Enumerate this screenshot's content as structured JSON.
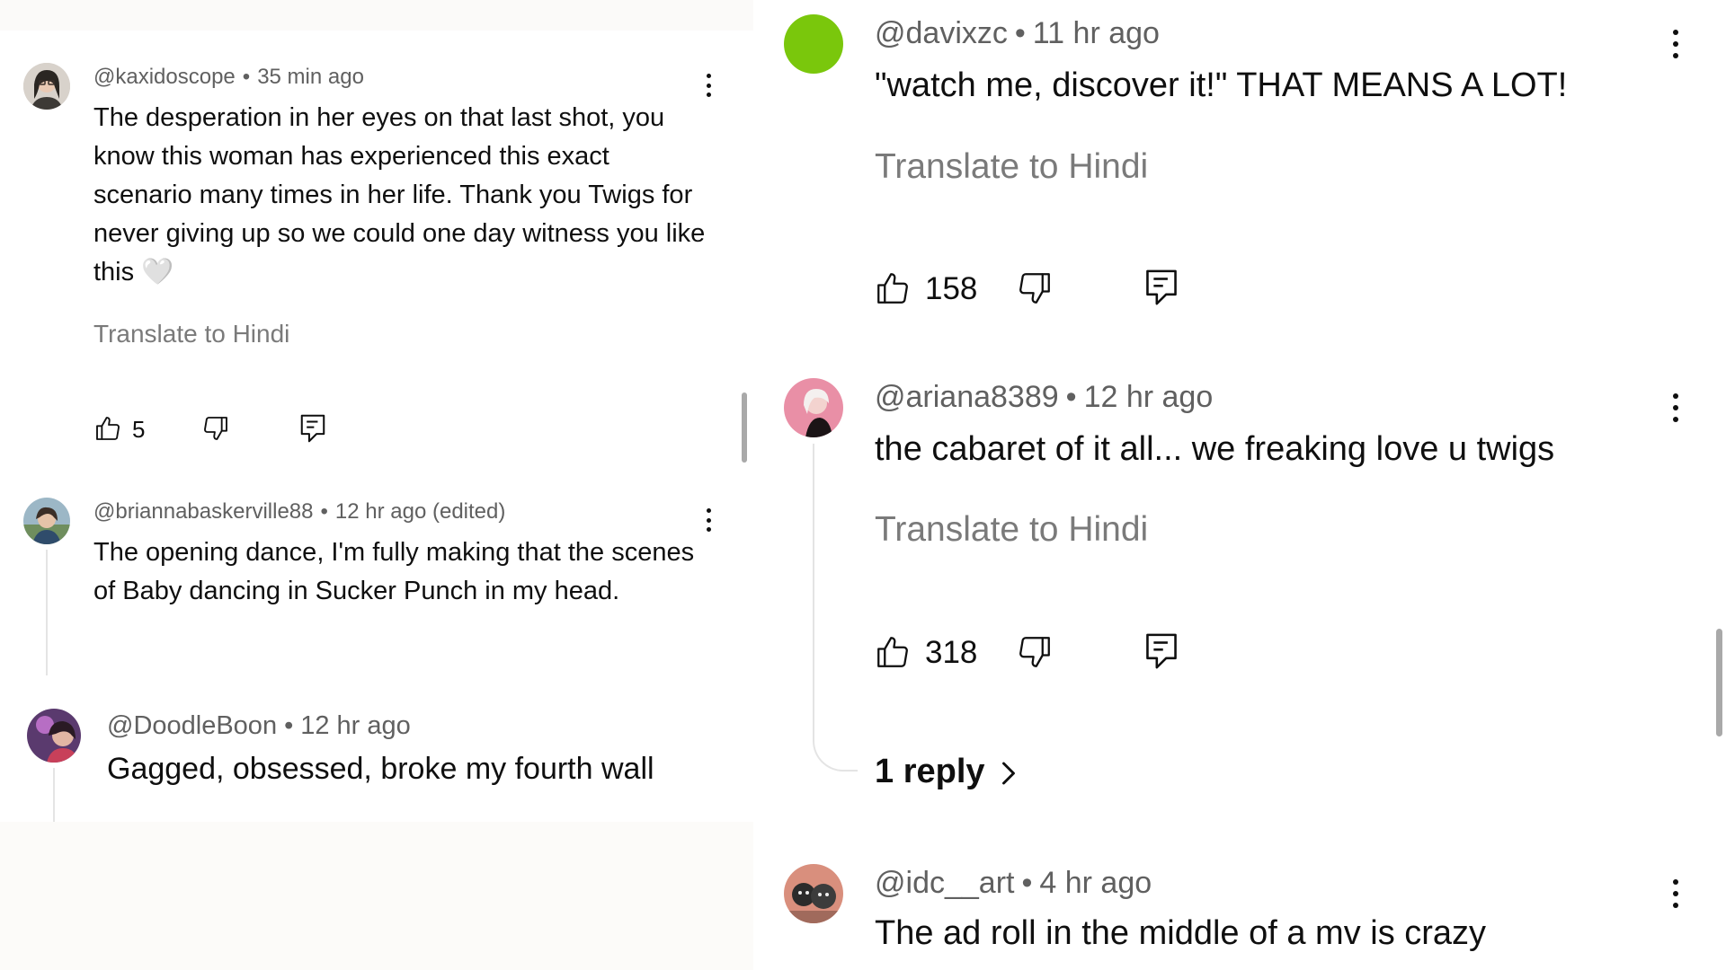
{
  "left": {
    "comments": [
      {
        "handle": "@kaxidoscope",
        "time": "35 min ago",
        "text": "The desperation in her eyes on that last shot, you know this woman has experienced this exact scenario many times in her life. Thank you Twigs for never giving up so we could one day witness you like this 🤍",
        "translate": "Translate to Hindi",
        "likes": "5"
      },
      {
        "handle": "@briannabaskerville88",
        "time": "12 hr ago (edited)",
        "text": "The opening dance, I'm fully making that the scenes of Baby dancing in Sucker Punch in my head."
      },
      {
        "handle": "@DoodleBoon",
        "time": "12 hr ago",
        "text": "Gagged, obsessed, broke my fourth wall"
      }
    ]
  },
  "right": {
    "comments": [
      {
        "handle": "@davixzc",
        "time": "11 hr ago",
        "text": "\"watch me, discover it!\" THAT MEANS A LOT!",
        "translate": "Translate to Hindi",
        "likes": "158"
      },
      {
        "handle": "@ariana8389",
        "time": "12 hr ago",
        "text": "the cabaret of it all... we freaking love u twigs",
        "translate": "Translate to Hindi",
        "likes": "318",
        "replies": "1 reply"
      },
      {
        "handle": "@idc__art",
        "time": "4 hr ago",
        "text": "The ad roll in the middle of a mv is crazy"
      }
    ]
  },
  "separator": "•",
  "icons": {
    "like": "thumbs-up-icon",
    "dislike": "thumbs-down-icon",
    "reply": "reply-comment-icon",
    "menu": "more-vertical-icon",
    "chevron": "chevron-right-icon"
  },
  "colors": {
    "text": "#0f0f0f",
    "meta": "#606060",
    "translate": "#7a7a7a",
    "green_avatar": "#7ac70c",
    "thread": "#e4e4e4"
  }
}
